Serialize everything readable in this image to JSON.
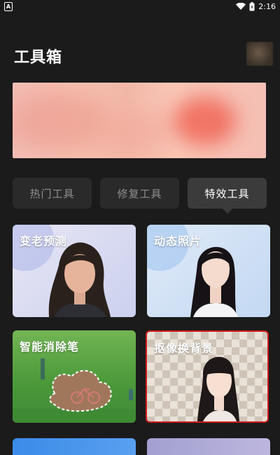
{
  "status_bar": {
    "left_icon": "A",
    "time": "2:16",
    "icons": [
      "wifi-icon",
      "battery-icon"
    ]
  },
  "header": {
    "title": "工具箱"
  },
  "tabs": [
    {
      "label": "热门工具",
      "active": false
    },
    {
      "label": "修复工具",
      "active": false
    },
    {
      "label": "特效工具",
      "active": true
    }
  ],
  "tools": [
    {
      "label": "变老预测"
    },
    {
      "label": "动态照片"
    },
    {
      "label": "智能消除笔"
    },
    {
      "label": "抠像换背景",
      "highlighted": true
    }
  ],
  "colors": {
    "background": "#1b1b1b",
    "tab_inactive": "#2a2a2a",
    "tab_active": "#3b3b3b",
    "highlight_border": "#d21b1b"
  }
}
